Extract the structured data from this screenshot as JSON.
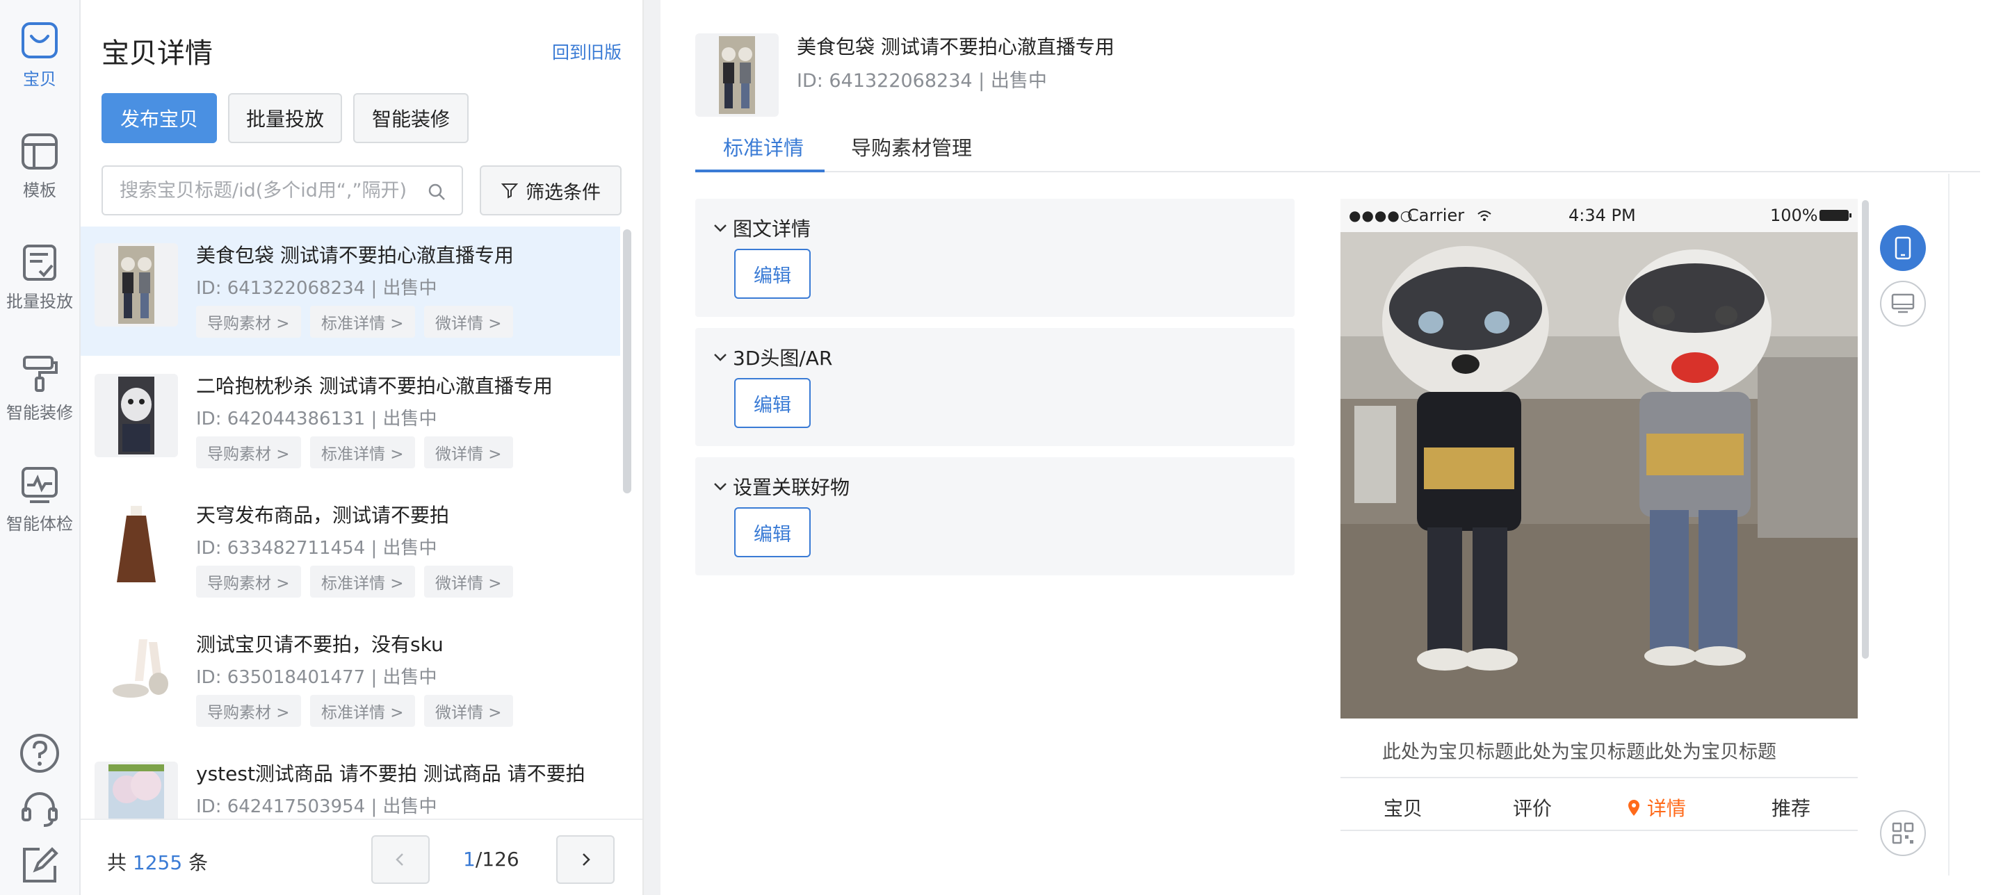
{
  "rail": {
    "items": [
      {
        "label": "宝贝",
        "icon": "bag-icon",
        "active": true
      },
      {
        "label": "模板",
        "icon": "template-icon",
        "active": false
      },
      {
        "label": "批量投放",
        "icon": "batch-publish-icon",
        "active": false
      },
      {
        "label": "智能装修",
        "icon": "paint-roller-icon",
        "active": false
      },
      {
        "label": "智能体检",
        "icon": "health-check-icon",
        "active": false
      }
    ],
    "bottom_icons": [
      "help-icon",
      "customer-service-icon",
      "feedback-edit-icon"
    ]
  },
  "list_panel": {
    "title": "宝贝详情",
    "back_link": "回到旧版",
    "buttons": {
      "publish": "发布宝贝",
      "batch": "批量投放",
      "decorate": "智能装修"
    },
    "search": {
      "placeholder": "搜索宝贝标题/id(多个id用“,”隔开)"
    },
    "filter_label": "筛选条件",
    "items": [
      {
        "title": "美食包袋 测试请不要拍心澈直播专用",
        "meta": "ID: 641322068234 | 出售中",
        "chips": [
          "导购素材 >",
          "标准详情 >",
          "微详情 >"
        ],
        "selected": true
      },
      {
        "title": "二哈抱枕秒杀 测试请不要拍心澈直播专用",
        "meta": "ID: 642044386131 | 出售中",
        "chips": [
          "导购素材 >",
          "标准详情 >",
          "微详情 >"
        ],
        "selected": false
      },
      {
        "title": "天穹发布商品，测试请不要拍",
        "meta": "ID: 633482711454 | 出售中",
        "chips": [
          "导购素材 >",
          "标准详情 >",
          "微详情 >"
        ],
        "selected": false
      },
      {
        "title": "测试宝贝请不要拍，没有sku",
        "meta": "ID: 635018401477 | 出售中",
        "chips": [
          "导购素材 >",
          "标准详情 >",
          "微详情 >"
        ],
        "selected": false
      },
      {
        "title": "ystest测试商品 请不要拍 测试商品 请不要拍",
        "meta": "ID: 642417503954 | 出售中",
        "chips": [],
        "selected": false
      }
    ],
    "footer": {
      "total_prefix": "共",
      "total_count": "1255",
      "total_suffix": "条",
      "current_page": "1",
      "total_pages": "/126"
    }
  },
  "detail": {
    "title": "美食包袋 测试请不要拍心澈直播专用",
    "meta": "ID: 641322068234 | 出售中",
    "tabs": [
      {
        "label": "标准详情",
        "active": true
      },
      {
        "label": "导购素材管理",
        "active": false
      }
    ],
    "sections": [
      {
        "title": "图文详情",
        "edit_label": "编辑"
      },
      {
        "title": "3D头图/AR",
        "edit_label": "编辑"
      },
      {
        "title": "设置关联好物",
        "edit_label": "编辑"
      }
    ],
    "preview": {
      "status": {
        "dots": "●●●●○",
        "carrier": "Carrier",
        "time": "4:34 PM",
        "battery": "100%"
      },
      "product_title": "此处为宝贝标题此处为宝贝标题此处为宝贝标题",
      "tabs": [
        {
          "label": "宝贝",
          "active": false
        },
        {
          "label": "评价",
          "active": false
        },
        {
          "label": "详情",
          "active": true
        },
        {
          "label": "推荐",
          "active": false
        }
      ]
    },
    "tools": [
      "mobile-icon",
      "desktop-icon",
      "qrcode-icon"
    ]
  },
  "colors": {
    "accent": "#3a7bd5",
    "primary_button": "#4a90e2",
    "selected_row": "#e8f2fd",
    "active_preview_tab": "#ff6a1a"
  }
}
